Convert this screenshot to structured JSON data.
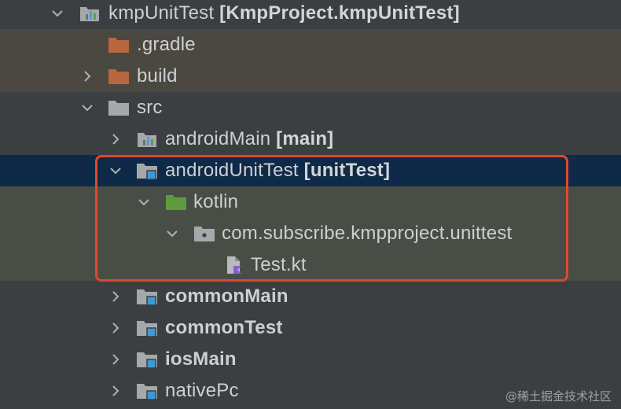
{
  "tree": {
    "root": {
      "name": "kmpUnitTest",
      "module": "[KmpProject.kmpUnitTest]",
      "state": "expanded",
      "icon": "module-folder-icon"
    },
    "items": [
      {
        "label": ".gradle",
        "state": "leaf",
        "icon": "excluded-folder-icon"
      },
      {
        "label": "build",
        "state": "collapsed",
        "icon": "excluded-folder-icon"
      },
      {
        "label": "src",
        "state": "expanded",
        "icon": "folder-icon"
      },
      {
        "label": "androidMain",
        "suffix": "[main]",
        "state": "collapsed",
        "icon": "module-folder-icon"
      },
      {
        "label": "androidUnitTest",
        "suffix": "[unitTest]",
        "state": "expanded",
        "icon": "source-set-folder-icon",
        "selected": true
      },
      {
        "label": "kotlin",
        "state": "expanded",
        "icon": "test-sources-folder-icon"
      },
      {
        "label": "com.subscribe.kmpproject.unittest",
        "state": "expanded",
        "icon": "package-icon"
      },
      {
        "label": "Test.kt",
        "state": "leaf",
        "icon": "kotlin-file-icon"
      },
      {
        "label": "commonMain",
        "state": "collapsed",
        "icon": "source-set-folder-icon"
      },
      {
        "label": "commonTest",
        "state": "collapsed",
        "icon": "source-set-folder-icon"
      },
      {
        "label": "iosMain",
        "state": "collapsed",
        "icon": "source-set-folder-icon"
      },
      {
        "label": "nativePc",
        "state": "collapsed",
        "icon": "source-set-folder-icon"
      }
    ]
  },
  "watermark": "@稀土掘金技术社区",
  "colors": {
    "background": "#3c3f41",
    "excluded_row": "#4a4841",
    "selected_row": "#0e2a48",
    "test_row": "#484e45",
    "highlight_box": "#e0472f",
    "excluded_folder": "#b8673f",
    "test_folder": "#5d9b3c",
    "source_set_badge": "#3d9ad6"
  }
}
